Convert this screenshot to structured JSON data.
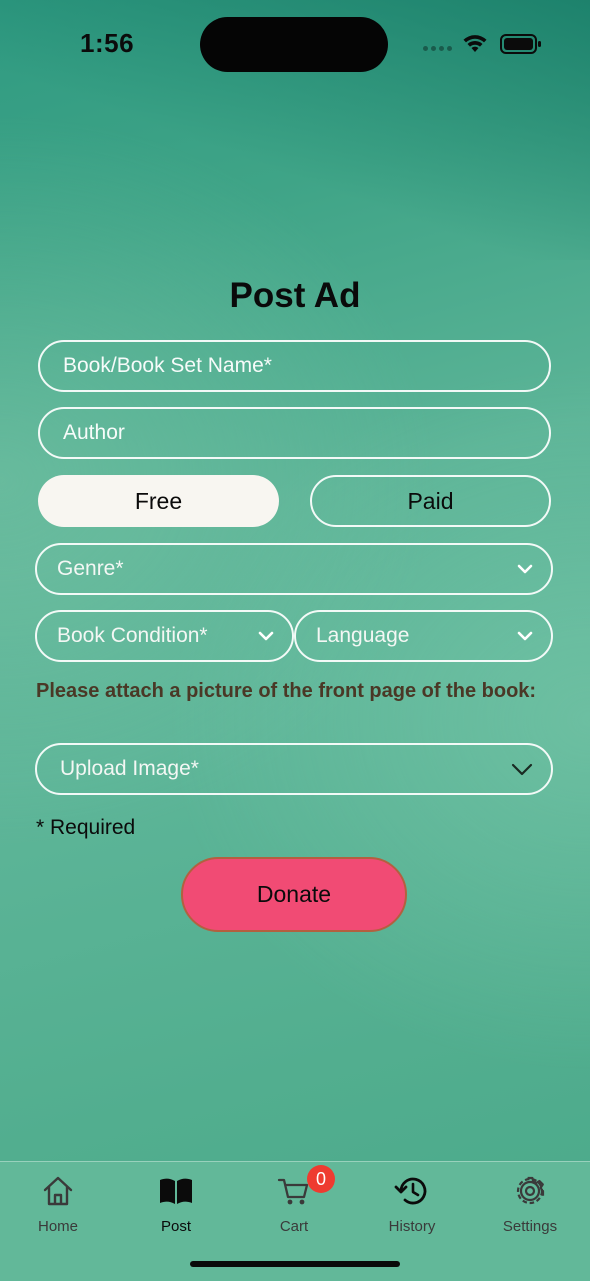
{
  "status_bar": {
    "time": "1:56"
  },
  "page": {
    "title": "Post Ad"
  },
  "form": {
    "book_name_placeholder": "Book/Book Set Name*",
    "book_name_value": "",
    "author_placeholder": "Author",
    "author_value": "",
    "price_type": {
      "options": [
        "Free",
        "Paid"
      ],
      "selected": "Free"
    },
    "genre_label": "Genre*",
    "condition_label": "Book Condition*",
    "language_label": "Language",
    "attach_instruction": "Please attach a picture of the front page of the book:",
    "upload_label": "Upload Image*",
    "required_note": "* Required",
    "submit_label": "Donate"
  },
  "tab_bar": {
    "items": [
      {
        "label": "Home",
        "icon": "house-icon"
      },
      {
        "label": "Post",
        "icon": "open-book-icon"
      },
      {
        "label": "Cart",
        "icon": "cart-icon"
      },
      {
        "label": "History",
        "icon": "history-icon"
      },
      {
        "label": "Settings",
        "icon": "gear-icon"
      }
    ],
    "active": "Post",
    "cart_badge": "0"
  },
  "colors": {
    "donate_button": "#f14b74",
    "attach_text": "#4a3826",
    "selected_toggle": "#f8f6f1",
    "badge": "#ee3b30"
  }
}
